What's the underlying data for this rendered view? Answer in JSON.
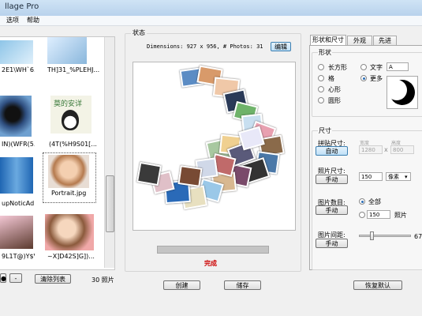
{
  "window": {
    "title": "llage Pro"
  },
  "menu": {
    "items": [
      "选项",
      "帮助"
    ]
  },
  "photo_list": {
    "thumbs": [
      {
        "caption": "2E1\\WH`6..."
      },
      {
        "caption": "TH]31_%PLEHJ..."
      },
      {
        "caption": "IN)(WFR(5..."
      },
      {
        "caption": "(4T(%H9S01[..."
      },
      {
        "caption": "upNoticAd..."
      },
      {
        "caption": "Portrait.jpg"
      },
      {
        "caption": "9L1T@)Y$V..."
      },
      {
        "caption": "~X]D42S]G])..."
      }
    ],
    "sticker_text": "莫的安详",
    "clear_label": "清除列表",
    "count_text": "30 照片",
    "minus_label": "-"
  },
  "preview": {
    "group_label": "状态",
    "dimensions_text": "Dimensions: 927 x 956, # Photos: 31",
    "edit_label": "编辑",
    "status_text": "完成",
    "progress": 1.0
  },
  "actions": {
    "create_label": "创建",
    "save_label": "储存",
    "reset_label": "恢复默认"
  },
  "tabs": [
    "形状和尺寸",
    "外观",
    "先进"
  ],
  "shape": {
    "group_label": "形状",
    "options": [
      "长方形",
      "格",
      "心形",
      "圆形"
    ],
    "right_options": [
      "文字",
      "更多"
    ],
    "text_value": "A",
    "selected": "更多"
  },
  "size": {
    "group_label": "尺寸",
    "collage_size_label": "拼贴尺寸:",
    "auto_label": "自动",
    "width_label": "宽度",
    "height_label": "高度",
    "width_value": "1280",
    "height_value": "800",
    "times": "x",
    "photo_size_label": "照片尺寸:",
    "manual_label": "手动",
    "photo_size_value": "150",
    "unit_value": "像素",
    "photo_count_label": "图片数目:",
    "all_label": "全部",
    "count_value": "150",
    "photo_unit": "照片",
    "spacing_label": "图片间距:",
    "spacing_value": "67",
    "spacing_level": 0.5
  },
  "colors": {
    "accent": "#3c7fb1",
    "status_red": "#cc0000",
    "progress": "#c4c4c4"
  }
}
